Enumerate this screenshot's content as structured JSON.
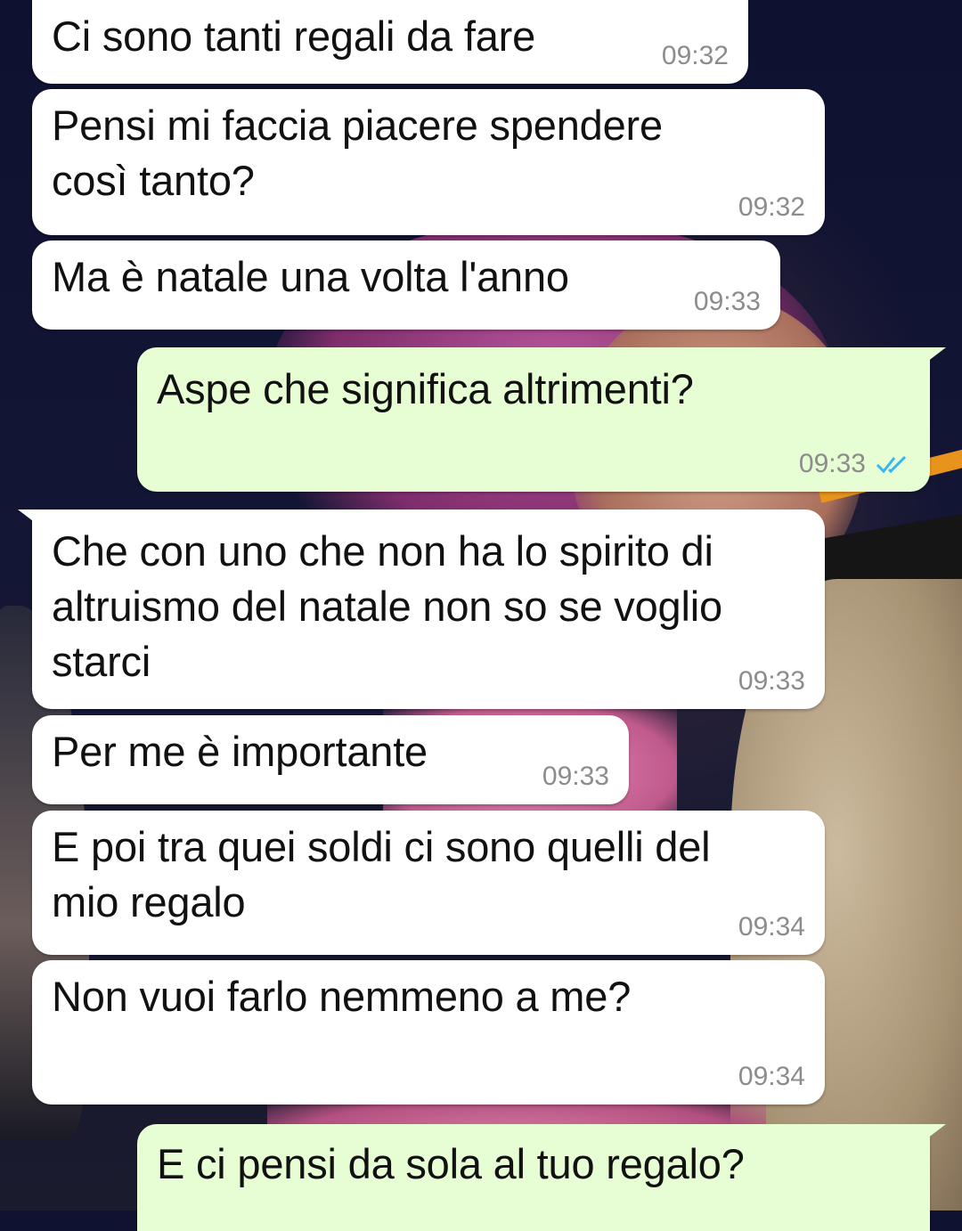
{
  "colors": {
    "incoming_bubble": "#ffffff",
    "outgoing_bubble": "#e7fdd4",
    "timestamp": "#8c8c8c",
    "read_ticks": "#34b7f1"
  },
  "messages": [
    {
      "direction": "incoming",
      "text": "Ci sono tanti regali da fare",
      "time": "09:32"
    },
    {
      "direction": "incoming",
      "text": "Pensi mi faccia piacere spendere\ncosì tanto?",
      "time": "09:32"
    },
    {
      "direction": "incoming",
      "text": "Ma è natale una volta l'anno",
      "time": "09:33"
    },
    {
      "direction": "outgoing",
      "text": "Aspe che significa altrimenti?",
      "time": "09:33",
      "status": "read",
      "status_icon": "double-check-icon"
    },
    {
      "direction": "incoming",
      "text": "Che con uno che non ha lo spirito di\naltruismo del natale non so se voglio\nstarci",
      "time": "09:33"
    },
    {
      "direction": "incoming",
      "text": "Per me è importante",
      "time": "09:33"
    },
    {
      "direction": "incoming",
      "text": "E poi tra quei soldi ci sono quelli del\nmio regalo",
      "time": "09:34"
    },
    {
      "direction": "incoming",
      "text": "Non vuoi farlo nemmeno a me?",
      "time": "09:34"
    },
    {
      "direction": "outgoing",
      "text": "E ci pensi da sola al tuo regalo?",
      "time": ""
    }
  ]
}
